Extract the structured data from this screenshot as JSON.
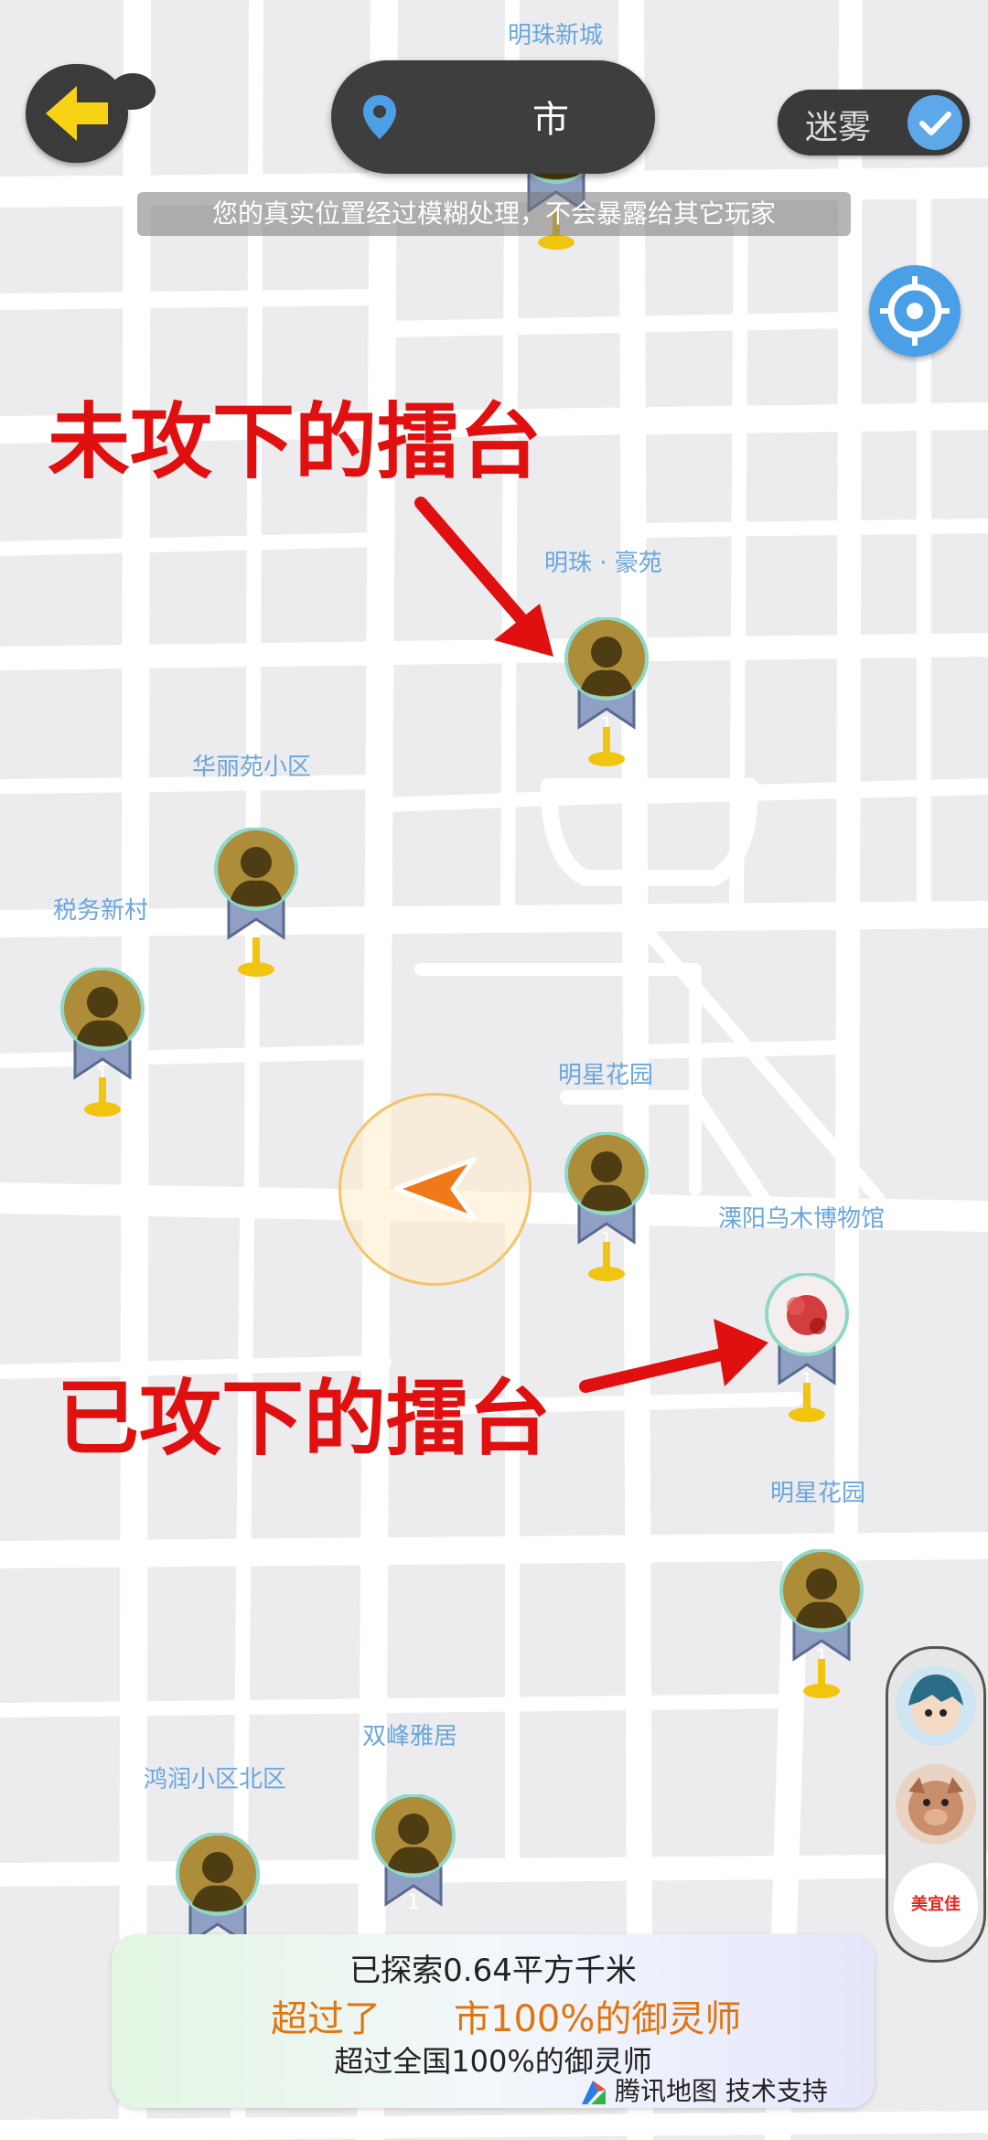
{
  "map": {
    "place_labels": [
      "明珠新城",
      "明珠 · 豪苑",
      "华丽苑小区",
      "税务新村",
      "明星花园",
      "溧阳乌木博物馆",
      "明星花园",
      "双峰雅居",
      "鸿润小区北区"
    ],
    "marker_level_label": "1"
  },
  "header": {
    "city_suffix": "市",
    "fog_label": "迷雾",
    "privacy_note": "您的真实位置经过模糊处理，不会暴露给其它玩家"
  },
  "annotations": {
    "unconquered": "未攻下的擂台",
    "conquered": "已攻下的擂台"
  },
  "side_panel": {
    "brand_label": "美宜佳"
  },
  "stats": {
    "explored": "已探索0.64平方千米",
    "city_prefix": "超过了",
    "city_rank": "市100%的御灵师",
    "national_rank": "超过全国100%的御灵师",
    "credit": "腾讯地图 技术支持"
  },
  "colors": {
    "accent_blue": "#4a9fe6",
    "annotation_red": "#e01010",
    "highlight_orange": "#e0750f"
  }
}
